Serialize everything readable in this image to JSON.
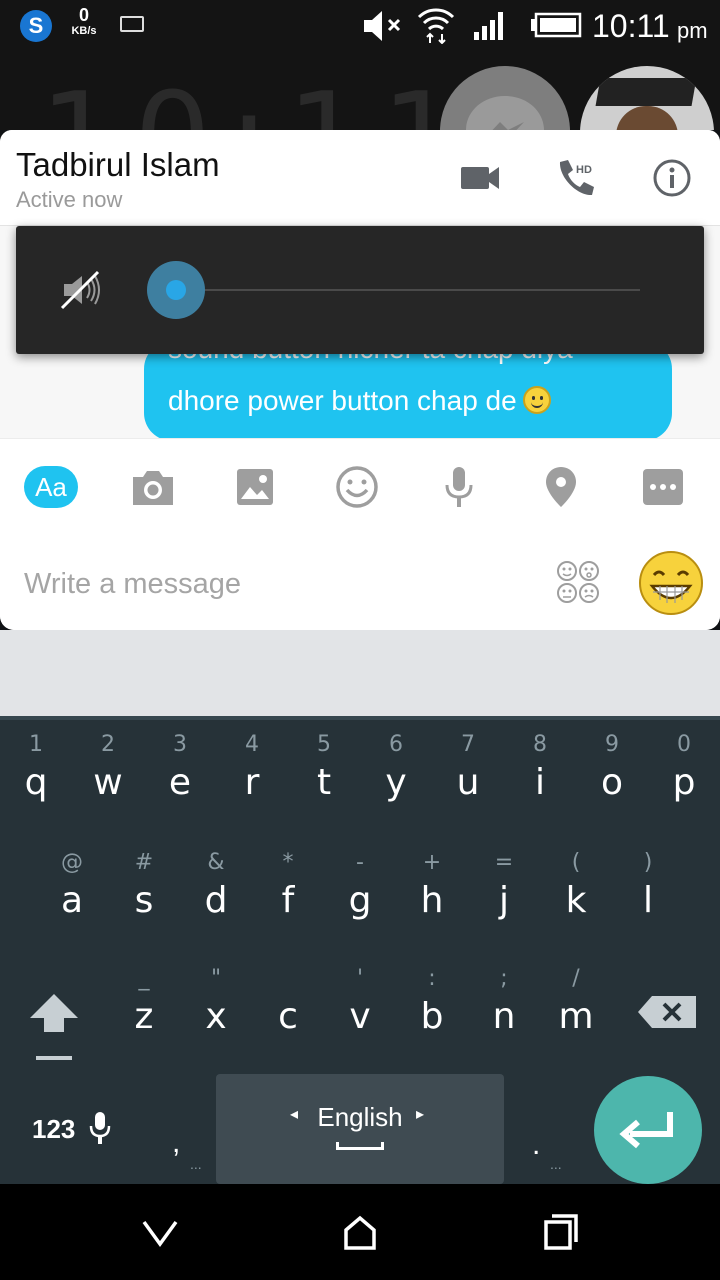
{
  "status_bar": {
    "app_icon_letter": "S",
    "net_speed_value": "0",
    "net_speed_unit": "KB/s",
    "time": "10:11",
    "ampm": "pm",
    "icons": [
      "volume-muted-icon",
      "wifi-icon",
      "signal-icon",
      "battery-icon",
      "keyboard-icon"
    ]
  },
  "background": {
    "lock_clock": "10:11"
  },
  "chat": {
    "contact_name": "Tadbirul Islam",
    "contact_status": "Active now",
    "header_actions": [
      "video-call-icon",
      "phone-hd-icon",
      "info-icon"
    ],
    "hd_badge": "HD",
    "message_partial": "sound button nicher ta chap diya",
    "message_line2": "dhore power button chap de",
    "bubble_color": "#1fc3f0"
  },
  "volume": {
    "level": 0,
    "muted": true,
    "accent": "#29a6e6"
  },
  "composer": {
    "aa_label": "Aa",
    "tools": [
      "camera-icon",
      "gallery-icon",
      "emoji-icon",
      "mic-icon",
      "location-icon",
      "more-icon"
    ],
    "placeholder": "Write a message"
  },
  "keyboard": {
    "row1": [
      {
        "hint": "1",
        "ch": "q"
      },
      {
        "hint": "2",
        "ch": "w"
      },
      {
        "hint": "3",
        "ch": "e"
      },
      {
        "hint": "4",
        "ch": "r"
      },
      {
        "hint": "5",
        "ch": "t"
      },
      {
        "hint": "6",
        "ch": "y"
      },
      {
        "hint": "7",
        "ch": "u"
      },
      {
        "hint": "8",
        "ch": "i"
      },
      {
        "hint": "9",
        "ch": "o"
      },
      {
        "hint": "0",
        "ch": "p"
      }
    ],
    "row2": [
      {
        "hint": "@",
        "ch": "a"
      },
      {
        "hint": "#",
        "ch": "s"
      },
      {
        "hint": "&",
        "ch": "d"
      },
      {
        "hint": "*",
        "ch": "f"
      },
      {
        "hint": "-",
        "ch": "g"
      },
      {
        "hint": "+",
        "ch": "h"
      },
      {
        "hint": "=",
        "ch": "j"
      },
      {
        "hint": "(",
        "ch": "k"
      },
      {
        "hint": ")",
        "ch": "l"
      }
    ],
    "row3": [
      {
        "hint": "_",
        "ch": "z"
      },
      {
        "hint": "\"",
        "ch": "x"
      },
      {
        "hint": "",
        "ch": "c"
      },
      {
        "hint": "'",
        "ch": "v"
      },
      {
        "hint": ":",
        "ch": "b"
      },
      {
        "hint": ";",
        "ch": "n"
      },
      {
        "hint": "/",
        "ch": "m"
      }
    ],
    "num_label": "123",
    "comma": ",",
    "space_label": "English",
    "period": ".",
    "accent": "#4db6ac"
  },
  "nav": {
    "buttons": [
      "back-icon",
      "home-icon",
      "recents-icon"
    ]
  }
}
